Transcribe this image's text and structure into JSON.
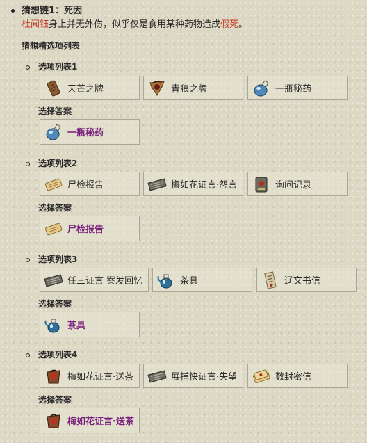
{
  "clue": {
    "title": "猜想链1：死因",
    "desc_name": "杜闻钰",
    "desc_mid": "身上并无外伤，似乎仅是食用某种药物造成",
    "desc_highlight": "假死",
    "desc_end": "。"
  },
  "list_heading": "猜想槽选项列表",
  "answer_label": "选择答案",
  "groups": [
    {
      "title": "选项列表1",
      "options": [
        {
          "label": "天芒之牌",
          "icon": "wooden-tablet-icon"
        },
        {
          "label": "青狼之牌",
          "icon": "wolf-token-icon"
        },
        {
          "label": "一瓶秘药",
          "icon": "potion-bottle-icon"
        }
      ],
      "answer": {
        "label": "一瓶秘药",
        "icon": "potion-bottle-icon"
      }
    },
    {
      "title": "选项列表2",
      "options": [
        {
          "label": "尸检报告",
          "icon": "scroll-icon"
        },
        {
          "label": "梅如花证言·怨言",
          "icon": "testimony-scroll-icon"
        },
        {
          "label": "询问记录",
          "icon": "record-tablet-icon"
        }
      ],
      "answer": {
        "label": "尸检报告",
        "icon": "scroll-icon"
      }
    },
    {
      "title": "选项列表3",
      "options": [
        {
          "label": "任三证言 案发回忆",
          "icon": "testimony-scroll-icon"
        },
        {
          "label": "茶具",
          "icon": "teapot-icon"
        },
        {
          "label": "辽文书信",
          "icon": "letter-icon"
        }
      ],
      "answer": {
        "label": "茶具",
        "icon": "teapot-icon"
      }
    },
    {
      "title": "选项列表4",
      "options": [
        {
          "label": "梅如花证言·送茶",
          "icon": "testimony-bag-icon"
        },
        {
          "label": "展捕快证言·失望",
          "icon": "testimony-scroll-icon"
        },
        {
          "label": "数封密信",
          "icon": "sealed-letters-icon"
        }
      ],
      "answer": {
        "label": "梅如花证言·送茶",
        "icon": "testimony-bag-icon"
      }
    }
  ]
}
